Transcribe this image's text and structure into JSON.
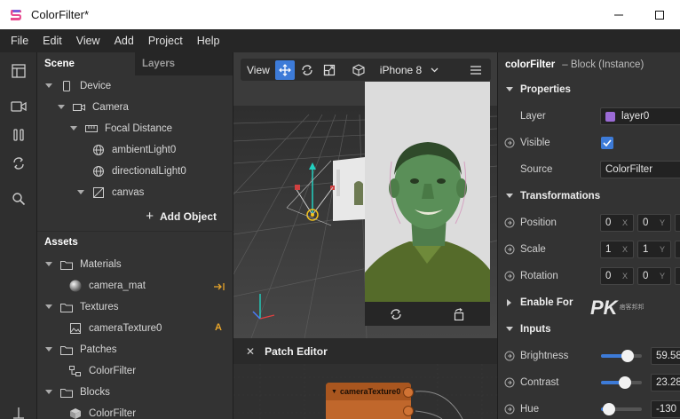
{
  "window": {
    "title": "ColorFilter*"
  },
  "menu": [
    "File",
    "Edit",
    "View",
    "Add",
    "Project",
    "Help"
  ],
  "scene_panel": {
    "tabs": [
      "Scene",
      "Layers"
    ],
    "tree": [
      {
        "label": "Device",
        "icon": "phone-icon"
      },
      {
        "label": "Camera",
        "icon": "camera-icon"
      },
      {
        "label": "Focal Distance",
        "icon": "focal-distance-icon"
      },
      {
        "label": "ambientLight0",
        "icon": "light-icon"
      },
      {
        "label": "directionalLight0",
        "icon": "light-icon"
      },
      {
        "label": "canvas",
        "icon": "canvas-icon"
      }
    ],
    "add_object": "Add Object"
  },
  "assets_panel": {
    "title": "Assets",
    "tree": [
      {
        "label": "Materials",
        "icon": "folder-icon"
      },
      {
        "label": "camera_mat",
        "icon": "material-sphere-icon"
      },
      {
        "label": "Textures",
        "icon": "folder-icon"
      },
      {
        "label": "cameraTexture0",
        "icon": "image-icon",
        "badge": "A"
      },
      {
        "label": "Patches",
        "icon": "folder-icon"
      },
      {
        "label": "ColorFilter",
        "icon": "patch-icon"
      },
      {
        "label": "Blocks",
        "icon": "folder-icon"
      },
      {
        "label": "ColorFilter",
        "icon": "block-icon"
      }
    ]
  },
  "viewport": {
    "view_label": "View",
    "device": "iPhone 8"
  },
  "patch_editor": {
    "title": "Patch Editor",
    "node": "cameraTexture0"
  },
  "inspector": {
    "name": "colorFilter",
    "type": "– Block (Instance)",
    "sections": {
      "properties": "Properties",
      "transformations": "Transformations",
      "enable_for": "Enable For",
      "inputs": "Inputs"
    },
    "layer": {
      "label": "Layer",
      "value": "layer0",
      "color": "#9b6bd6"
    },
    "visible": {
      "label": "Visible",
      "checked": true
    },
    "source": {
      "label": "Source",
      "value": "ColorFilter"
    },
    "position": {
      "label": "Position",
      "x": "0",
      "y": "0"
    },
    "scale": {
      "label": "Scale",
      "x": "1",
      "y": "1"
    },
    "rotation": {
      "label": "Rotation",
      "x": "0",
      "y": "0"
    },
    "brightness": {
      "label": "Brightness",
      "value": "59.58",
      "level": 0.65
    },
    "contrast": {
      "label": "Contrast",
      "value": "23.28",
      "level": 0.58
    },
    "hue": {
      "label": "Hue",
      "value": "-130",
      "level": 0.2
    }
  },
  "axis_labels": {
    "x": "X",
    "y": "Y"
  },
  "watermark": {
    "brand": "PK",
    "sub": "痞客邦邦"
  },
  "colors": {
    "accent": "#3d7bd8",
    "patch_node": "#c0672c"
  }
}
